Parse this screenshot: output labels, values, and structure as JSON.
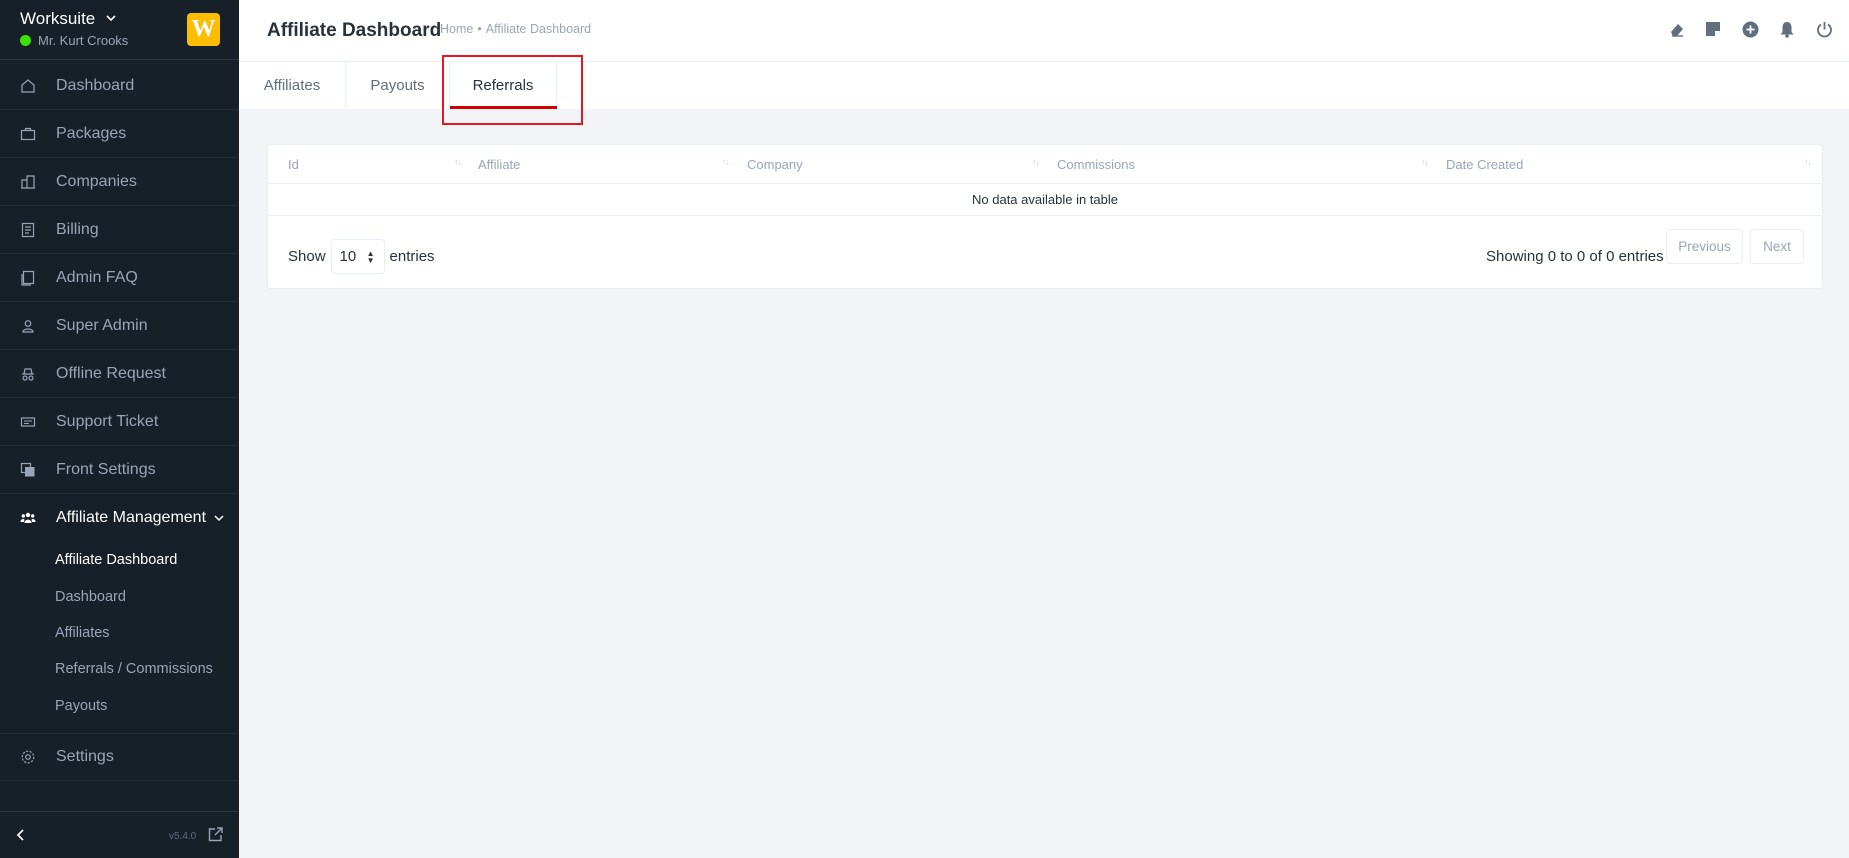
{
  "brand": {
    "name": "Worksuite",
    "user": "Mr. Kurt Crooks",
    "logo_letter": "W",
    "logo_color": "#fcbd01",
    "status_color": "#39e500"
  },
  "sidebar": {
    "items": [
      {
        "label": "Dashboard",
        "icon": "house-icon"
      },
      {
        "label": "Packages",
        "icon": "briefcase-icon"
      },
      {
        "label": "Companies",
        "icon": "buildings-icon"
      },
      {
        "label": "Billing",
        "icon": "receipt-icon"
      },
      {
        "label": "Admin FAQ",
        "icon": "document-icon"
      },
      {
        "label": "Super Admin",
        "icon": "user-icon"
      },
      {
        "label": "Offline Request",
        "icon": "incognito-icon"
      },
      {
        "label": "Support Ticket",
        "icon": "ticket-icon"
      },
      {
        "label": "Front Settings",
        "icon": "stack-icon"
      },
      {
        "label": "Affiliate Management",
        "icon": "people-icon"
      }
    ],
    "sub_items": [
      {
        "label": "Affiliate Dashboard"
      },
      {
        "label": "Dashboard"
      },
      {
        "label": "Affiliates"
      },
      {
        "label": "Referrals / Commissions"
      },
      {
        "label": "Payouts"
      }
    ],
    "settings": {
      "label": "Settings",
      "icon": "gear-icon"
    },
    "version": "v5.4.0"
  },
  "header": {
    "title": "Affiliate Dashboard",
    "breadcrumb": {
      "home": "Home",
      "separator": "•",
      "current": "Affiliate Dashboard"
    },
    "icons": [
      "eraser-icon",
      "sticky-note-icon",
      "plus-circle-icon",
      "bell-icon",
      "power-icon"
    ]
  },
  "tabs": [
    {
      "label": "Affiliates"
    },
    {
      "label": "Payouts"
    },
    {
      "label": "Referrals",
      "active": true
    }
  ],
  "table": {
    "columns": [
      "Id",
      "Affiliate",
      "Company",
      "Commissions",
      "Date Created"
    ],
    "empty_message": "No data available in table",
    "show_label": "Show",
    "page_size": "10",
    "entries_label": "entries",
    "info": "Showing 0 to 0 of 0 entries",
    "previous": "Previous",
    "next": "Next"
  },
  "colors": {
    "sidebar_bg": "#171f29",
    "accent_underline": "#d30000",
    "highlight_box": "#e2191f"
  }
}
